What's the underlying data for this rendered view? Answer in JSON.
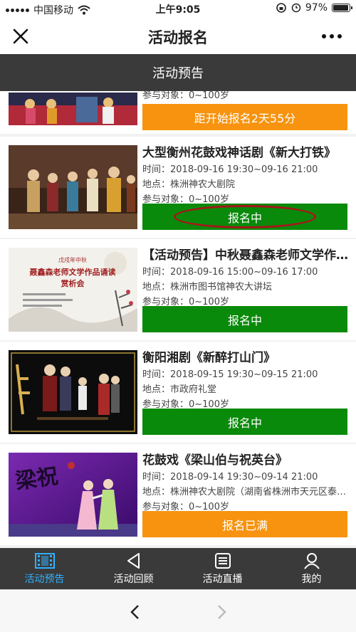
{
  "status": {
    "carrier": "中国移动",
    "time": "上午9:05",
    "battery": "97%",
    "battery_level": 0.97
  },
  "header": {
    "title": "活动报名"
  },
  "tab": {
    "label": "活动预告"
  },
  "partial_card": {
    "meta": "参与对象：0~100岁",
    "button": "距开始报名2天55分"
  },
  "events": [
    {
      "title": "大型衡州花鼓戏神话剧《新大打铁》",
      "time": "时间：2018-09-16 19:30~09-16 21:00",
      "place": "地点：株洲神农大剧院",
      "audience": "参与对象：0~100岁",
      "button": "报名中"
    },
    {
      "title": "【活动预告】中秋聂鑫森老师文学作品...",
      "time": "时间：2018-09-16 15:00~09-16 17:00",
      "place": "地点：株洲市图书馆神农大讲坛",
      "audience": "参与对象：0~100岁",
      "button": "报名中"
    },
    {
      "title": "衡阳湘剧《新醉打山门》",
      "time": "时间：2018-09-15 19:30~09-15 21:00",
      "place": "地点：市政府礼堂",
      "audience": "参与对象：0~100岁",
      "button": "报名中"
    },
    {
      "title": "花鼓戏《梁山伯与祝英台》",
      "time": "时间：2018-09-14 19:30~09-14 21:00",
      "place": "地点：株洲神农大剧院（湖南省株洲市天元区泰山...",
      "audience": "参与对象：0~100岁",
      "button": "报名已满"
    }
  ],
  "poster_text": {
    "moon": "戊戌年中秋",
    "headline": "聂鑫森老师文学作品诵读",
    "subline": "赏析会",
    "calligraphy": "梁祝"
  },
  "bottom_nav": [
    {
      "label": "活动预告",
      "icon": "film-icon"
    },
    {
      "label": "活动回顾",
      "icon": "play-triangle-icon"
    },
    {
      "label": "活动直播",
      "icon": "list-doc-icon"
    },
    {
      "label": "我的",
      "icon": "user-icon"
    }
  ],
  "colors": {
    "green": "#0a8a0a",
    "orange": "#f7930e",
    "active_blue": "#2fb0ff",
    "dark_bar": "#3a3a3a",
    "highlight_ring": "#a6161b"
  }
}
